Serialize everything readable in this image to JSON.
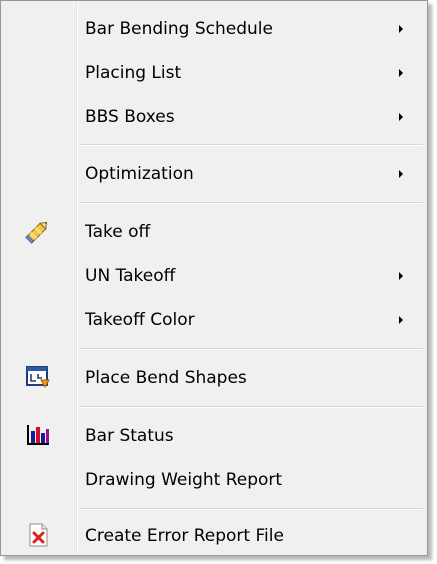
{
  "menu": {
    "items": [
      {
        "label": "Bar Bending Schedule",
        "has_submenu": true
      },
      {
        "label": "Placing List",
        "has_submenu": true
      },
      {
        "label": "BBS Boxes",
        "has_submenu": true
      },
      {
        "label": "Optimization",
        "has_submenu": true
      },
      {
        "label": "Take off",
        "has_submenu": false,
        "icon": "pencil-icon"
      },
      {
        "label": "UN Takeoff",
        "has_submenu": true
      },
      {
        "label": "Takeoff Color",
        "has_submenu": true
      },
      {
        "label": "Place Bend Shapes",
        "has_submenu": false,
        "icon": "place-bend-shapes-icon"
      },
      {
        "label": "Bar Status",
        "has_submenu": false,
        "icon": "bar-chart-icon"
      },
      {
        "label": "Drawing Weight Report",
        "has_submenu": false
      },
      {
        "label": "Create Error Report File",
        "has_submenu": false,
        "icon": "error-report-icon"
      }
    ]
  },
  "colors": {
    "menu_background": "#f0f0f0",
    "border": "#979797",
    "separator": "#d7d7d7"
  }
}
